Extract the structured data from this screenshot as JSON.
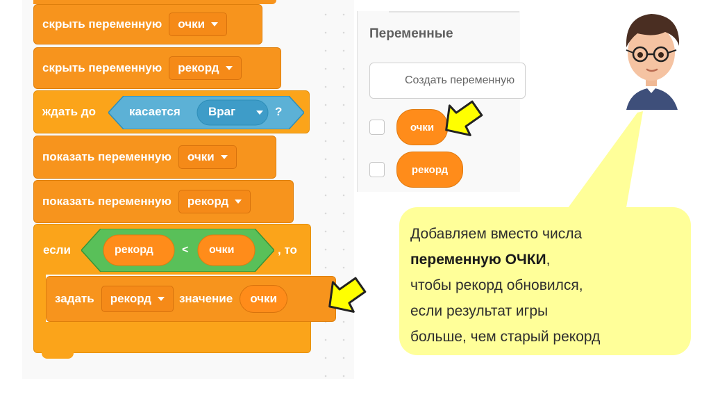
{
  "blocks": {
    "hide_var_1": {
      "label": "скрыть переменную",
      "var": "очки"
    },
    "hide_var_2": {
      "label": "скрыть переменную",
      "var": "рекорд"
    },
    "wait_until": {
      "label": "ждать до",
      "touching": "касается",
      "target": "Враг",
      "q": "?"
    },
    "show_var_1": {
      "label": "показать переменную",
      "var": "очки"
    },
    "show_var_2": {
      "label": "показать переменную",
      "var": "рекорд"
    },
    "if_block": {
      "label": "если",
      "left": "рекорд",
      "op": "<",
      "right": "очки",
      "then": ", то"
    },
    "set_var": {
      "label": "задать",
      "var": "рекорд",
      "value_label": "значение",
      "value": "очки"
    }
  },
  "palette": {
    "title": "Переменные",
    "create_button": "Создать переменную",
    "variables": [
      "очки",
      "рекорд"
    ]
  },
  "callout": {
    "line1": "Добавляем вместо числа",
    "line2_bold": "переменную ОЧКИ",
    "line2_rest": ",",
    "line3": "чтобы рекорд обновился,",
    "line4": "если результат игры",
    "line5": "больше, чем старый рекорд"
  },
  "icons": {
    "arrows": "yellow-arrow-icon",
    "avatar": "cartoon-teacher-avatar"
  },
  "colors": {
    "looks_block": "#f7941d",
    "control_block": "#fba41a",
    "sensing_block": "#5cb1d6",
    "operator_block": "#59c059",
    "callout_bg": "#ffff99",
    "arrow": "#ffff00"
  }
}
